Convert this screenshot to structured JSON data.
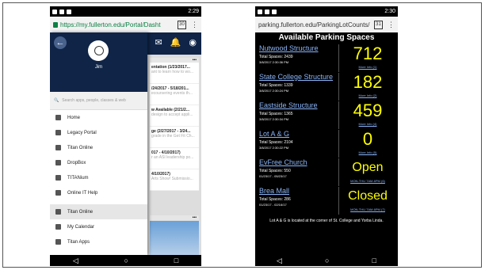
{
  "left": {
    "status_time": "2:29",
    "url": "https://my.fullerton.edu/Portal/Dasht",
    "tabs_count": "30",
    "user_name": "Jim",
    "search_placeholder": "Search apps, people, classes & web",
    "menu_primary": [
      {
        "label": "Home",
        "icon": "home-icon"
      },
      {
        "label": "Legacy Portal",
        "icon": "grid-icon"
      },
      {
        "label": "Titan Online",
        "icon": "card-icon"
      },
      {
        "label": "DropBox",
        "icon": "dropbox-icon"
      },
      {
        "label": "TITANium",
        "icon": "laptop-icon"
      },
      {
        "label": "Online IT Help",
        "icon": "help-icon"
      }
    ],
    "menu_secondary": [
      {
        "label": "Titan Online",
        "icon": "card-icon"
      },
      {
        "label": "My Calendar",
        "icon": "calendar-icon"
      },
      {
        "label": "Titan Apps",
        "icon": "apps-icon"
      }
    ],
    "cards": [
      {
        "title": "entation (1/23/2017...",
        "sub": "ant to learn how to wo..."
      },
      {
        "title": "/24/2017 - 5/18/201...",
        "sub": "ecoursering events th..."
      },
      {
        "title": "w Available (2/21/2...",
        "sub": "design to accept appli..."
      },
      {
        "title": "ge (2/27/2017 - 3/24...",
        "sub": "grade in the Get Fit Ch..."
      },
      {
        "title": "017 - 4/10/2017)",
        "sub": "r an ASI leadership po..."
      },
      {
        "title": "4/10/2017)",
        "sub": "Arts Show! Submissio..."
      }
    ]
  },
  "right": {
    "status_time": "2:30",
    "url": "parking.fullerton.edu/ParkingLotCounts/",
    "tabs_count": "31",
    "title": "Available Parking Spaces",
    "lots": [
      {
        "name": "Nutwood Structure",
        "total": "Total Spaces: 2439",
        "date": "3/8/2017 2:30:36 PM",
        "count": "712",
        "more": "More Info (1)"
      },
      {
        "name": "State College Structure",
        "total": "Total Spaces: 1339",
        "date": "3/8/2017 2:30:24 PM",
        "count": "182",
        "more": "More Info (2)"
      },
      {
        "name": "Eastside Structure",
        "total": "Total Spaces: 1365",
        "date": "3/8/2017 2:30:34 PM",
        "count": "459",
        "more": "More Info (4)"
      },
      {
        "name": "Lot A & G",
        "total": "Total Spaces: 2104",
        "date": "3/8/2017 2:30:22 PM",
        "count": "0",
        "more": "More Info (5)"
      },
      {
        "name": "EvFree Church",
        "total": "Total Spaces: 550",
        "date": "01/23/17 - 05/23/17",
        "count": "Open",
        "more": "MON-THU 7AM-6PM (6)"
      },
      {
        "name": "Brea Mall",
        "total": "Total Spaces: 286",
        "date": "01/23/17 - 02/16/17",
        "count": "Closed",
        "more": "MON-THU 7AM-6PM (7)"
      }
    ],
    "note": "Lot A & G is located at the corner of St. College and Yorba Linda."
  },
  "softkeys": {
    "back": "◁",
    "home": "○",
    "recent": "□"
  },
  "colors": {
    "portal_navy": "#0f2447",
    "count_yellow": "#ffff00",
    "link_blue": "#8ab4f8"
  }
}
